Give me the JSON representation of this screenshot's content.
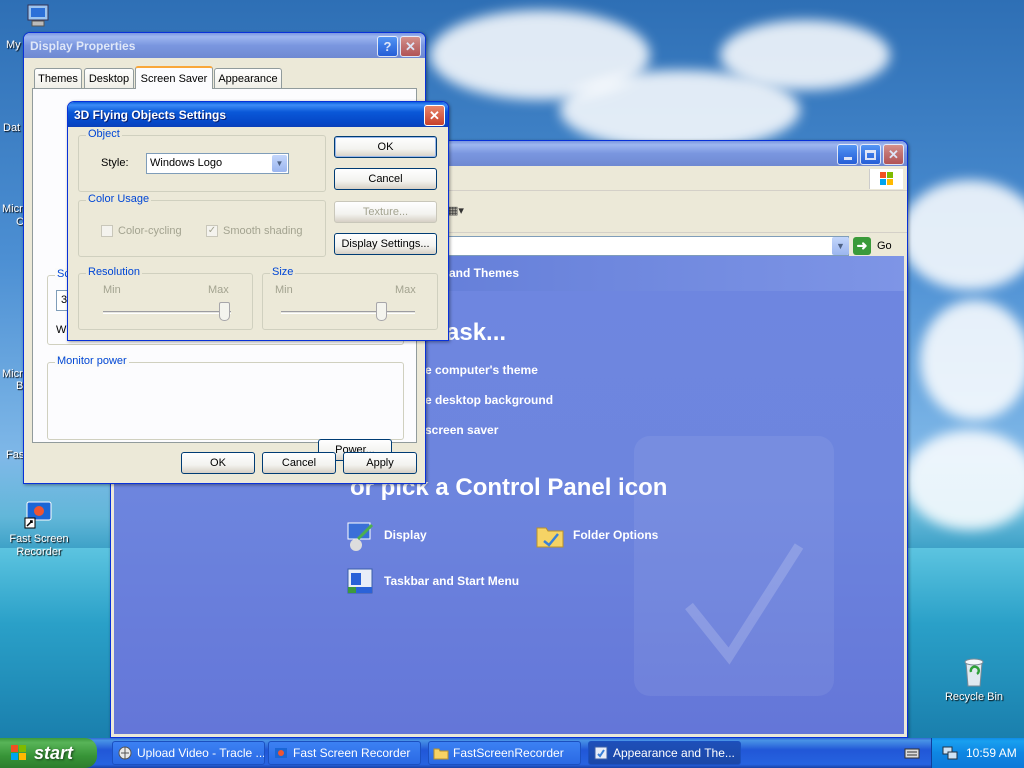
{
  "desktop": {
    "icons": [
      {
        "label": "My"
      },
      {
        "label": "Dat"
      },
      {
        "label": "Micro"
      },
      {
        "label": "C"
      },
      {
        "label": "Micro"
      },
      {
        "label": "B"
      },
      {
        "label": "Fas"
      },
      {
        "label": "Fast Screen Recorder"
      },
      {
        "label": "Recycle Bin"
      }
    ]
  },
  "control_panel": {
    "go_label": "Go",
    "category_title": "and Themes",
    "pick_task": "ask...",
    "tasks": [
      "e computer's theme",
      "e desktop background",
      "screen saver"
    ],
    "or_pick": "or pick a Control Panel icon",
    "icons": [
      "Display",
      "Folder Options",
      "Taskbar and Start Menu"
    ]
  },
  "display_properties": {
    "title": "Display Properties",
    "tabs": [
      "Themes",
      "Desktop",
      "Screen Saver",
      "Appearance"
    ],
    "active_tab": "Screen Saver",
    "screen_saver_group_partial": "Sc",
    "screen_saver_select_partial": "3D",
    "wait_partial": "W",
    "monitor_power_title": "Monitor power",
    "power_button": "Power...",
    "ok": "OK",
    "cancel": "Cancel",
    "apply": "Apply"
  },
  "flying_objects": {
    "title": "3D Flying Objects Settings",
    "object_group": "Object",
    "style_label": "Style:",
    "style_value": "Windows Logo",
    "color_group": "Color Usage",
    "color_cycling": "Color-cycling",
    "color_cycling_checked": false,
    "smooth_shading": "Smooth shading",
    "smooth_shading_checked": true,
    "resolution_group": "Resolution",
    "resolution_min": "Min",
    "resolution_max": "Max",
    "resolution_value": 0.95,
    "size_group": "Size",
    "size_min": "Min",
    "size_max": "Max",
    "size_value": 0.75,
    "ok": "OK",
    "cancel": "Cancel",
    "texture": "Texture...",
    "display_settings": "Display Settings..."
  },
  "taskbar": {
    "start": "start",
    "tasks": [
      {
        "label": "Upload Video - Tracle ..."
      },
      {
        "label": "Fast Screen Recorder"
      },
      {
        "label": "FastScreenRecorder"
      },
      {
        "label": "Appearance and The..."
      }
    ],
    "clock": "10:59 AM"
  },
  "colors": {
    "xp_blue": "#0a58d8",
    "cp_content": "#6d85de",
    "dialog_face": "#ece9d8",
    "group_title": "#0046d5"
  }
}
